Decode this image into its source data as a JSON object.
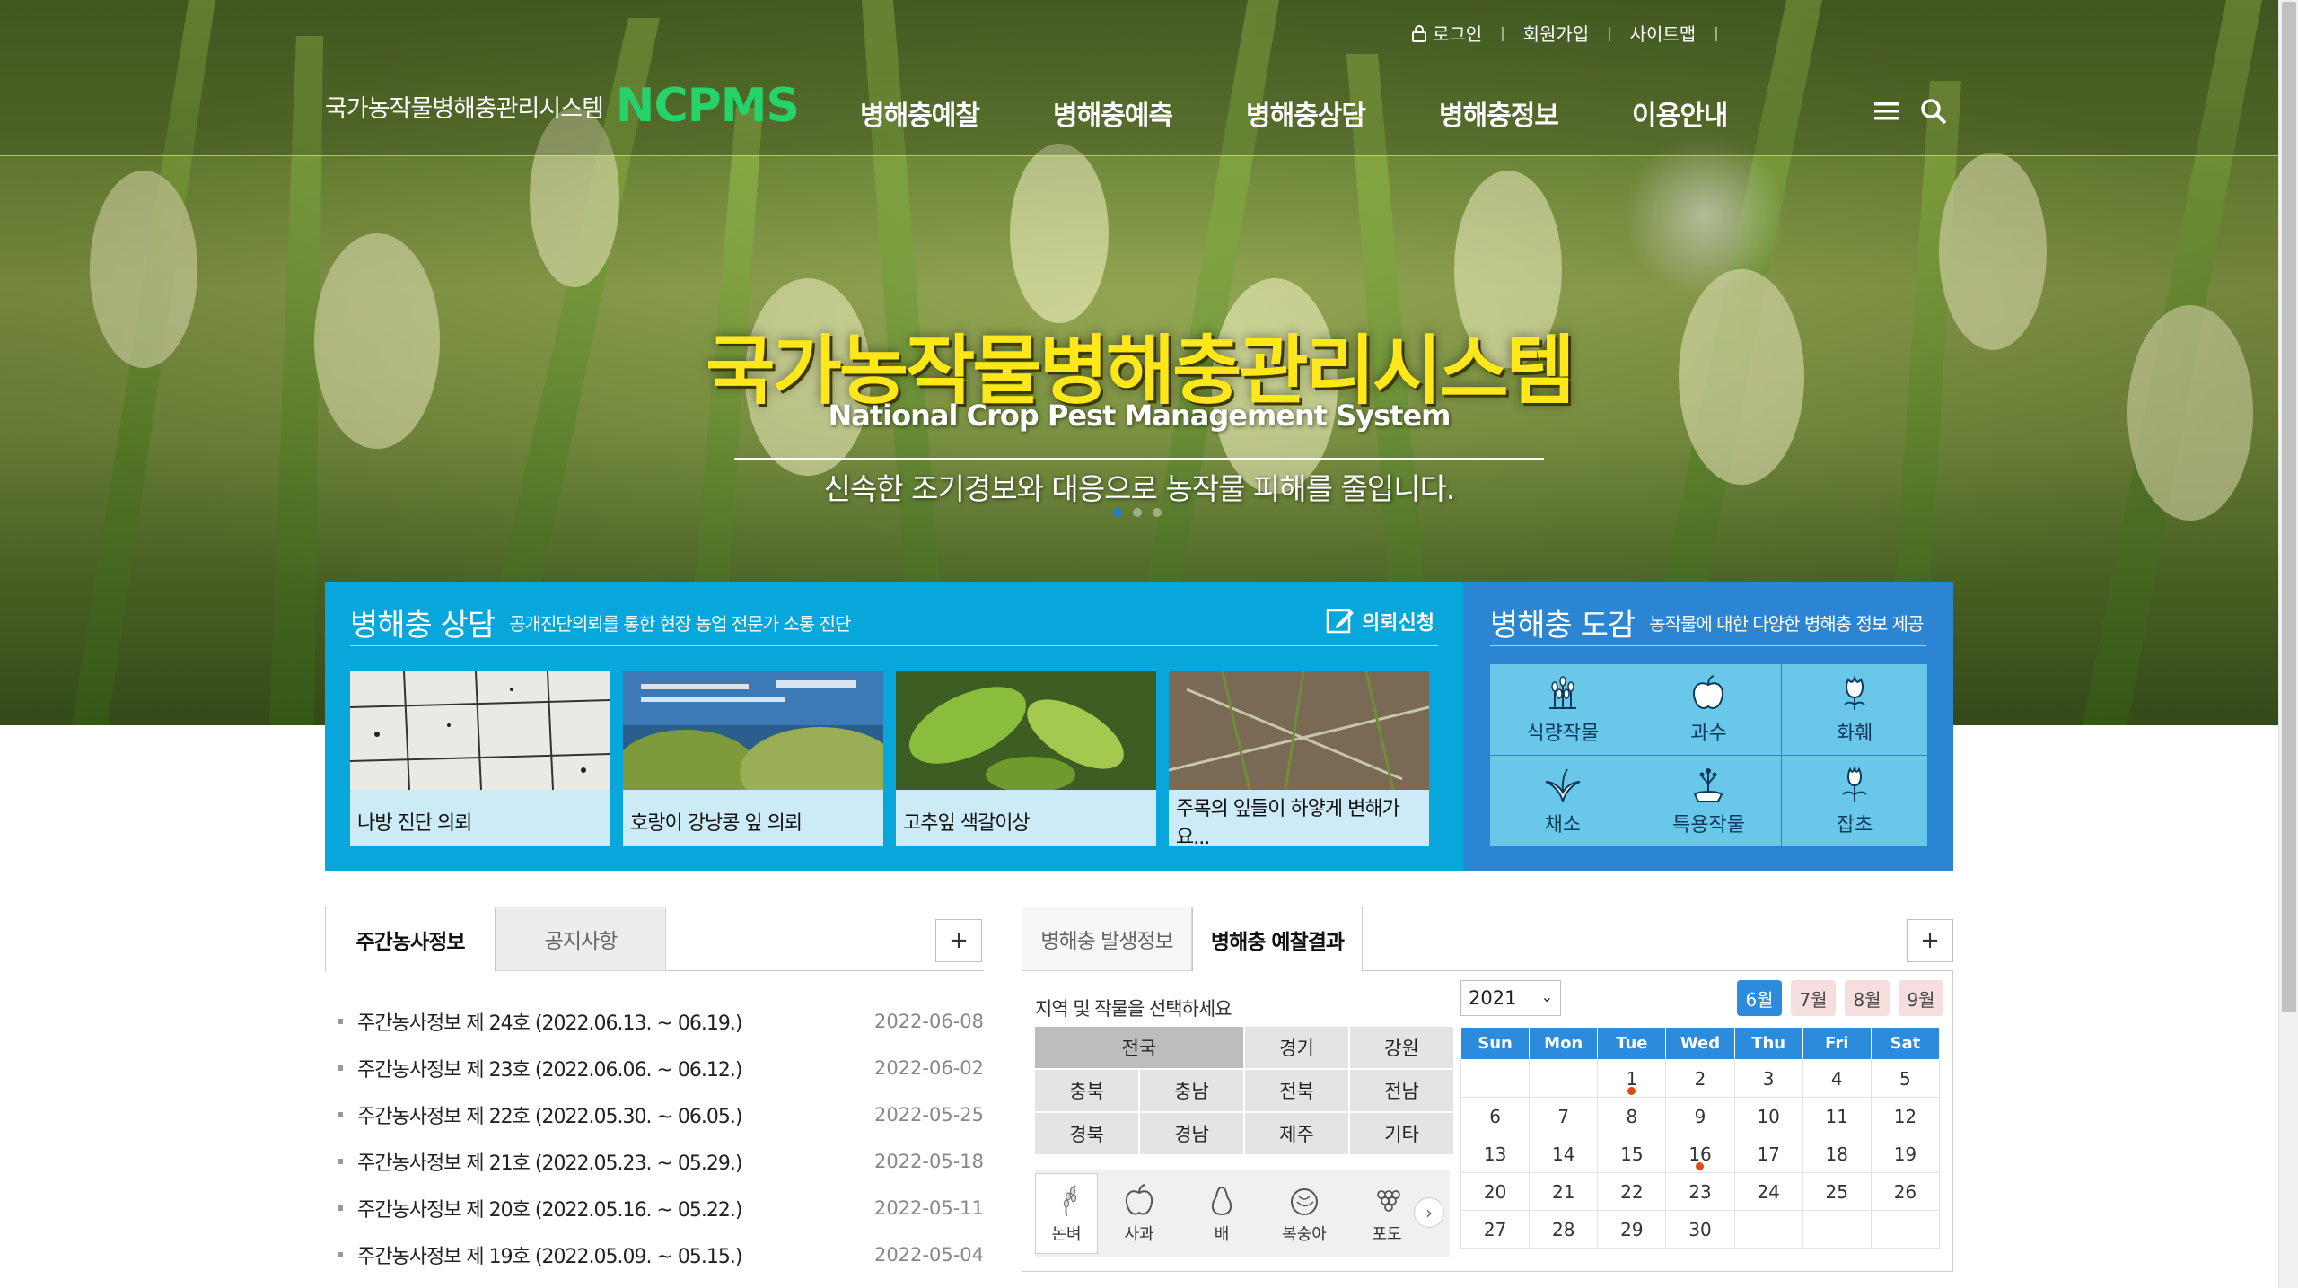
{
  "header": {
    "util": {
      "login": "로그인",
      "join": "회원가입",
      "sitemap": "사이트맵"
    },
    "logo_kr": "국가농작물병해충관리시스템",
    "logo_en": "NCPMS",
    "nav": [
      "병해충예찰",
      "병해충예측",
      "병해충상담",
      "병해충정보",
      "이용안내"
    ]
  },
  "hero": {
    "title": "국가농작물병해충관리시스템",
    "subtitle": "National Crop Pest Management System",
    "message": "신속한 조기경보와 대응으로 농작물 피해를 줄입니다."
  },
  "consult": {
    "title": "병해충 상담",
    "desc": "공개진단의뢰를 통한 현장 농업 전문가 소통 진단",
    "request_label": "의뢰신청",
    "cards": [
      {
        "caption": "나방 진단 의뢰"
      },
      {
        "caption": "호랑이 강낭콩 잎 의뢰"
      },
      {
        "caption": "고추잎 색갈이상"
      },
      {
        "caption": "주목의 잎들이 하얗게 변해가요..."
      }
    ]
  },
  "encyclopedia": {
    "title": "병해충 도감",
    "desc": "농작물에 대한 다양한 병해충 정보 제공",
    "items": [
      {
        "label": "식량작물",
        "icon": "grain-icon"
      },
      {
        "label": "과수",
        "icon": "apple-icon"
      },
      {
        "label": "화훼",
        "icon": "flower-icon"
      },
      {
        "label": "채소",
        "icon": "vegetable-icon"
      },
      {
        "label": "특용작물",
        "icon": "ginseng-icon"
      },
      {
        "label": "잡초",
        "icon": "weed-icon"
      }
    ]
  },
  "news": {
    "tabs": [
      "주간농사정보",
      "공지사항"
    ],
    "items": [
      {
        "title": "주간농사정보 제 24호 (2022.06.13. ~ 06.19.)",
        "date": "2022-06-08"
      },
      {
        "title": "주간농사정보 제 23호 (2022.06.06. ~ 06.12.)",
        "date": "2022-06-02"
      },
      {
        "title": "주간농사정보 제 22호 (2022.05.30. ~ 06.05.)",
        "date": "2022-05-25"
      },
      {
        "title": "주간농사정보 제 21호 (2022.05.23. ~ 05.29.)",
        "date": "2022-05-18"
      },
      {
        "title": "주간농사정보 제 20호 (2022.05.16. ~ 05.22.)",
        "date": "2022-05-11"
      },
      {
        "title": "주간농사정보 제 19호 (2022.05.09. ~ 05.15.)",
        "date": "2022-05-04"
      }
    ]
  },
  "forecast": {
    "tabs": [
      "병해충 발생정보",
      "병해충 예찰결과"
    ],
    "select_label": "지역 및 작물을 선택하세요",
    "regions": [
      "전국",
      "경기",
      "강원",
      "충북",
      "충남",
      "전북",
      "전남",
      "경북",
      "경남",
      "제주",
      "기타"
    ],
    "crops": [
      "논벼",
      "사과",
      "배",
      "복숭아",
      "포도"
    ],
    "year": "2021",
    "months": [
      "6월",
      "7월",
      "8월",
      "9월"
    ],
    "weekdays": [
      "Sun",
      "Mon",
      "Tue",
      "Wed",
      "Thu",
      "Fri",
      "Sat"
    ],
    "weeks": [
      [
        "",
        "",
        "1",
        "2",
        "3",
        "4",
        "5"
      ],
      [
        "6",
        "7",
        "8",
        "9",
        "10",
        "11",
        "12"
      ],
      [
        "13",
        "14",
        "15",
        "16",
        "17",
        "18",
        "19"
      ],
      [
        "20",
        "21",
        "22",
        "23",
        "24",
        "25",
        "26"
      ],
      [
        "27",
        "28",
        "29",
        "30",
        "",
        "",
        ""
      ]
    ],
    "event_days": [
      "1",
      "16"
    ],
    "plus": "+"
  },
  "colors": {
    "brand_green": "#25d36a",
    "hero_yellow": "#ffe71a",
    "consult_blue": "#07a7dc",
    "ency_blue": "#2b85d2",
    "calendar_blue": "#2c8bdc",
    "event_red": "#e14a12"
  }
}
